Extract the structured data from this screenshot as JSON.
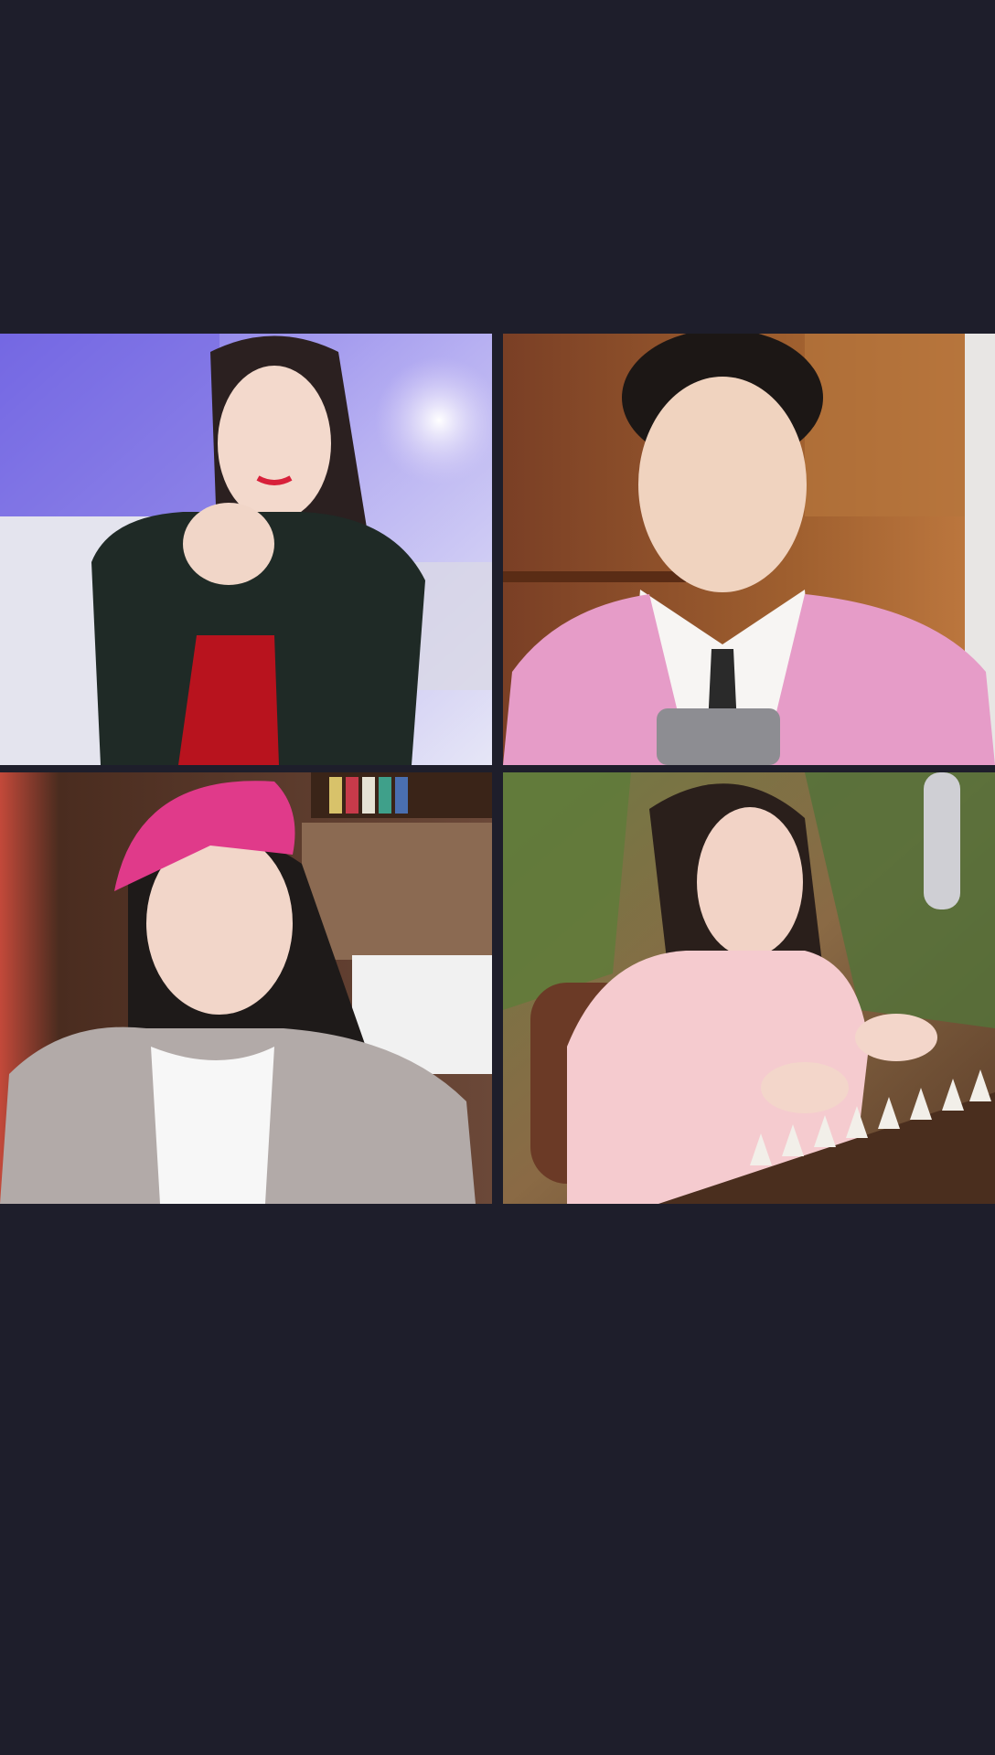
{
  "colors": {
    "background": "#1e1e2b",
    "tile1_backdrop": "#8f86e8",
    "tile2_backdrop": "#8a5030",
    "tile3_backdrop": "#5a3a2a",
    "tile4_backdrop": "#6b4a30"
  },
  "participants": [
    {
      "id": "p1",
      "label": "",
      "icon": "video-feed"
    },
    {
      "id": "p2",
      "label": "",
      "icon": "video-feed"
    },
    {
      "id": "p3",
      "label": "",
      "icon": "video-feed"
    },
    {
      "id": "p4",
      "label": "",
      "icon": "video-feed"
    }
  ]
}
